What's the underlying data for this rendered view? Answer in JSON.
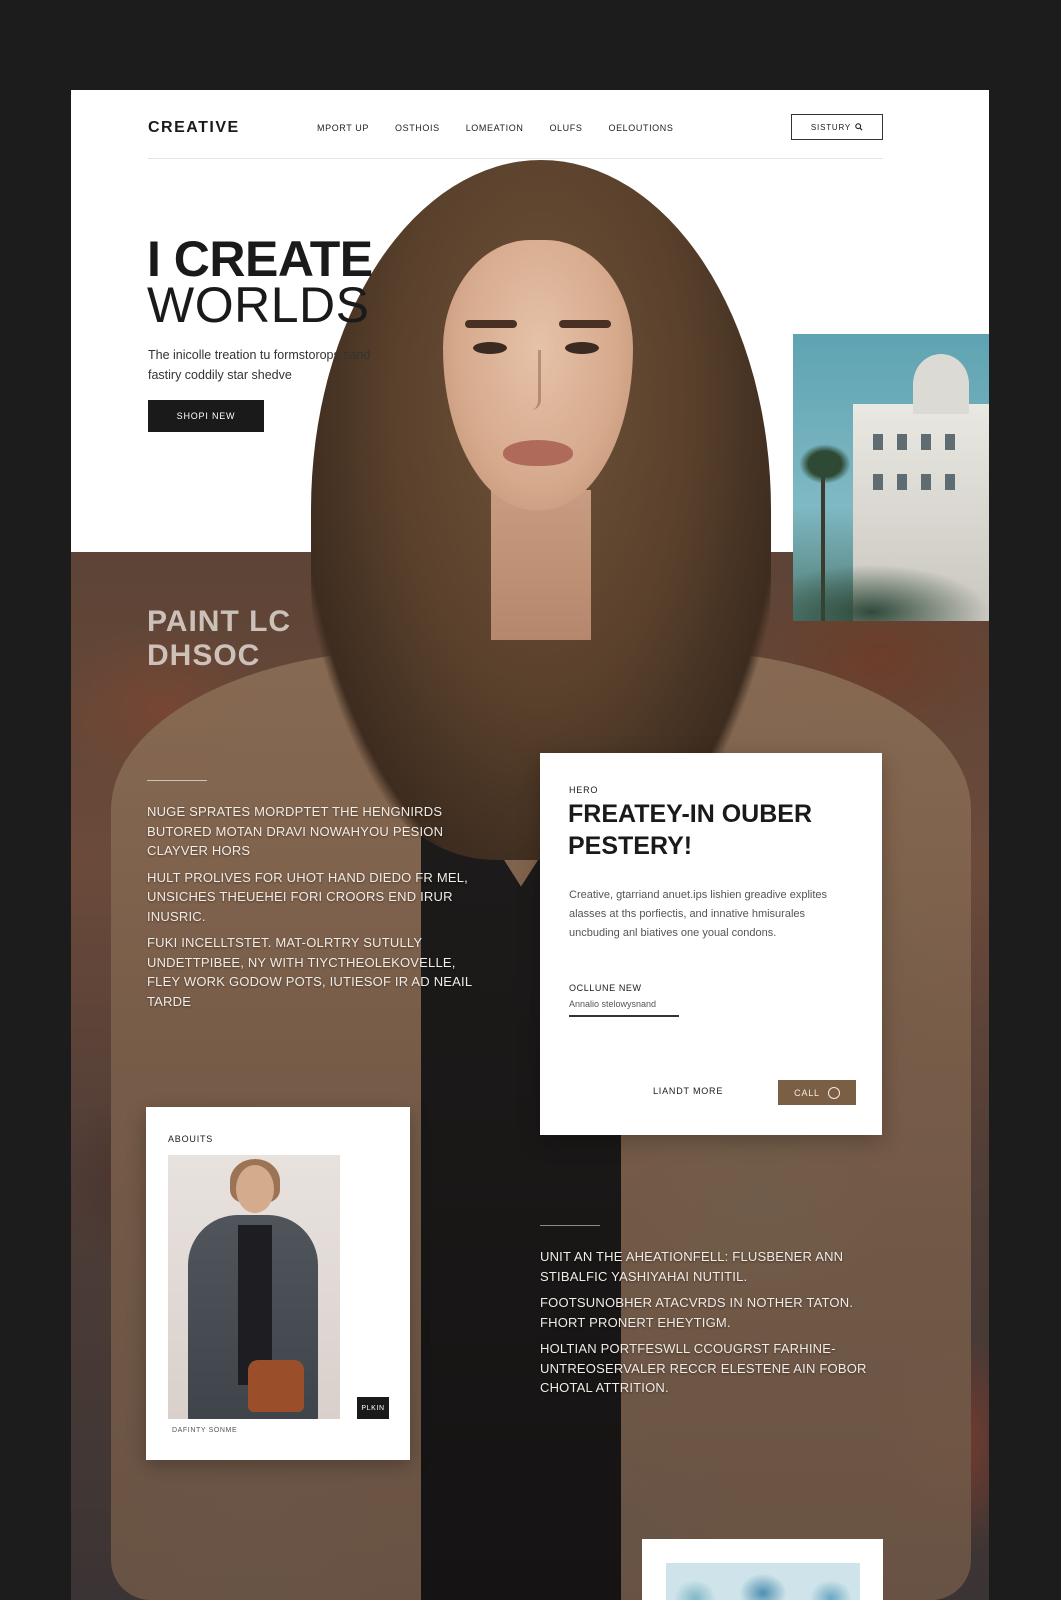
{
  "header": {
    "logo": "CREATIVE",
    "nav": [
      "MPORT UP",
      "OSTHOIS",
      "LOMEATION",
      "OLUFS",
      "OELOUTIONS"
    ],
    "cta_label": "SISTURY",
    "cta_icon": "search-icon"
  },
  "hero": {
    "title_line1": "I CREATE",
    "title_line2": "WORLDS",
    "subtitle": "The inicolle treation tu formstorops sand fastiry coddily star shedve",
    "button_label": "SHOPI NEW"
  },
  "painted": {
    "title_line1": "PAINT LC",
    "title_line2": "DHSOC"
  },
  "left_text": [
    "NUGE SPRATES MORDPTET THE HENGNIRDS BUTORED MOTAN DRAVI NOWAHYOU PESION CLAYVER HORS",
    "HULT PROLIVES FOR UHOT HAND DIEDO FR MEL, UNSICHES THEUEHEI FORI CROORS END IRUR INUSRIC.",
    "FUKI INCELLTSTET. MAT-OLRTRY SUTULLY UNDETTPIBEE, NY WITH TIYCTHEOLEKOVELLE, FLEY WORK GODOW POTS, IUTIESOF IR AD NEAIL TARDE"
  ],
  "card": {
    "eyebrow": "HERO",
    "title": "FREATEY-IN OUBER PESTERY!",
    "body": "Creative, gtarriand anuet.ips lishien greadive explites alasses at ths porfiectis, and innative hmisurales uncbuding anl biatives one youal condons.",
    "label": "OCLLUNE NEW",
    "link_label": "Annalio stelowysnand",
    "learn_label": "LIANDT MORE",
    "call_label": "CALL"
  },
  "abouts": {
    "label": "ABOUITS",
    "button_label": "PLKIN",
    "caption": "DAFINTY SONME"
  },
  "right_text": [
    "UNIT AN THE AHEATIONFELL: FLUSBENER ANN STIBALFIC YASHIYAHAI NUTITIL.",
    "FOOTSUNOBHER ATACVRDS IN NOTHER TATON. FHORT PRONERT EHEYTIGM.",
    "HOLTIAN PORTFESWLL CCOUGRST FARHINE-UNTREOSERVALER RECCR ELESTENE AIN FOBOR CHOTAL ATTRITION."
  ]
}
